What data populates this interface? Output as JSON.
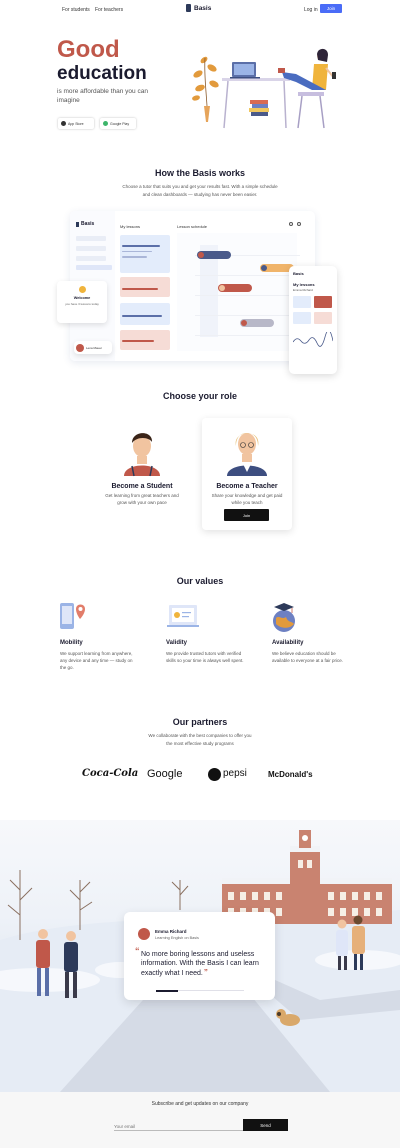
{
  "header": {
    "nav_left": [
      "For students",
      "For teachers"
    ],
    "brand": "Basis",
    "login": "Log in",
    "join": "Join"
  },
  "hero": {
    "title_line1": "Good",
    "title_line2": "education",
    "subtitle": "is more affordable than you can imagine",
    "store_buttons": [
      {
        "small": "Download on the",
        "label": "App Store"
      },
      {
        "small": "GET IT ON",
        "label": "Google Play"
      }
    ]
  },
  "how": {
    "title": "How the Basis works",
    "subtitle_1": "Choose a tutor that suits you and get your results fast. With a simple schedule",
    "subtitle_2": "and clean dashboards — studying has never been easier."
  },
  "dashboard": {
    "brand": "Basis",
    "column_1_title": "My lessons",
    "column_2_title": "Lesson schedule",
    "phone_title": "My lessons",
    "profile_name": "Emma Richard",
    "welcome": "Welcome",
    "welcome_sub": "you have 3 lessons today",
    "student_name": "Lena Mauer"
  },
  "roles": {
    "title": "Choose your role",
    "student_title": "Become a Student",
    "student_desc": "Get learning from great teachers and grow with your own pace",
    "teacher_title": "Become a Teacher",
    "teacher_desc": "Share your knowledge and get paid while you teach",
    "join_label": "Join"
  },
  "values": {
    "title": "Our values",
    "items": [
      {
        "title": "Mobility",
        "desc": "We support learning from anywhere, any device and any time — study on the go."
      },
      {
        "title": "Validity",
        "desc": "We provide trusted tutors with verified skills so your time is always well spent."
      },
      {
        "title": "Availability",
        "desc": "We believe education should be available to everyone at a fair price."
      }
    ]
  },
  "partners": {
    "title": "Our partners",
    "subtitle_1": "We collaborate with the best companies to offer you",
    "subtitle_2": "the most effective study programs",
    "logos": [
      "Coca-Cola",
      "Google",
      "pepsi",
      "McDonald's"
    ]
  },
  "testimonial": {
    "name": "Emma Richard",
    "role": "Learning English on Basis",
    "quote_1": "No more boring lessons and useless",
    "quote_2": "information. With the Basis I can learn",
    "quote_3": "exactly what I need."
  },
  "footer": {
    "label": "Subscribe and get updates on our company",
    "placeholder": "Your email",
    "button": "Send"
  }
}
